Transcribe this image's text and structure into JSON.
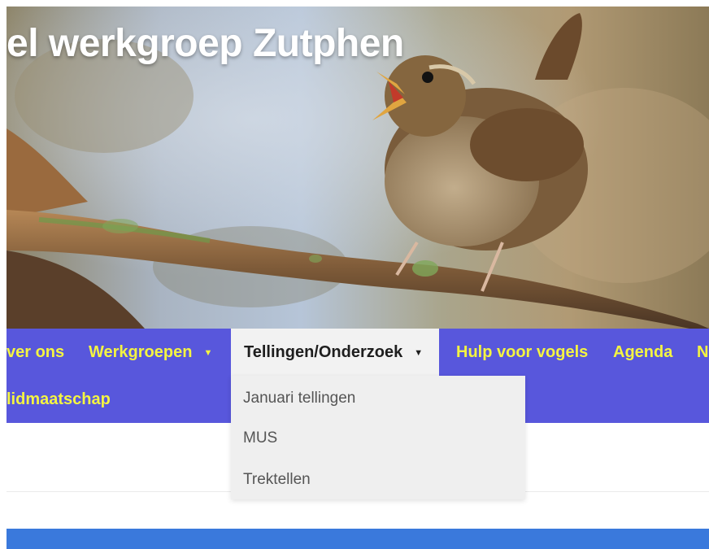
{
  "site": {
    "title": "el werkgroep Zutphen"
  },
  "hero": {
    "image": "wren-singing-on-branch"
  },
  "nav": {
    "items": [
      {
        "label": "ver ons"
      },
      {
        "label": "Werkgroepen",
        "caret": "▼"
      },
      {
        "label": "Tellingen/Onderzoek",
        "caret": "▼"
      },
      {
        "label": "Hulp voor vogels"
      },
      {
        "label": "Agenda"
      },
      {
        "label": "N"
      },
      {
        "label": "lidmaatschap"
      }
    ],
    "active": "Tellingen/Onderzoek"
  },
  "dropdown": {
    "items": [
      {
        "label": "Januari tellingen"
      },
      {
        "label": "MUS"
      },
      {
        "label": "Trektellen"
      }
    ]
  },
  "colors": {
    "nav_bg": "#5857dc",
    "nav_text": "#f4f442",
    "dropdown_bg": "#efefef",
    "footer_bar": "#3a79dc"
  }
}
